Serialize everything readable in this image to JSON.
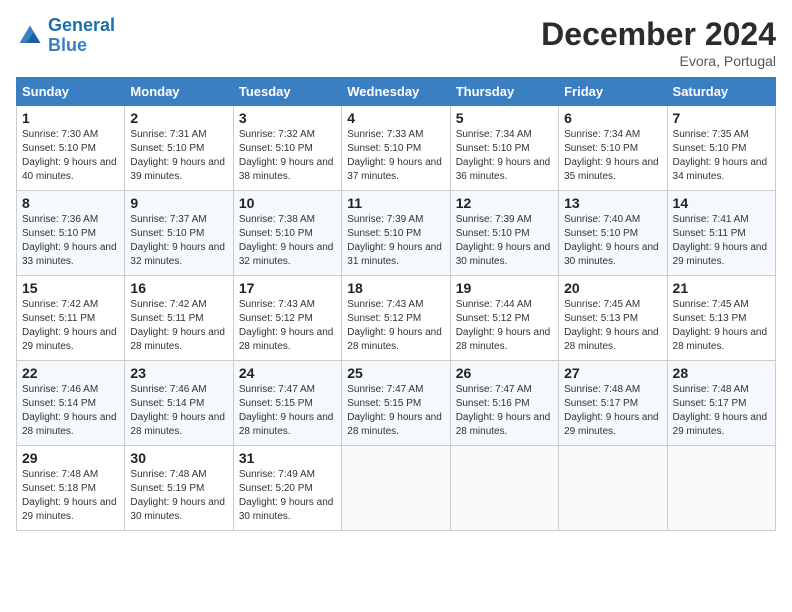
{
  "header": {
    "logo_line1": "General",
    "logo_line2": "Blue",
    "month": "December 2024",
    "location": "Evora, Portugal"
  },
  "weekdays": [
    "Sunday",
    "Monday",
    "Tuesday",
    "Wednesday",
    "Thursday",
    "Friday",
    "Saturday"
  ],
  "weeks": [
    [
      {
        "day": "1",
        "sunrise": "7:30 AM",
        "sunset": "5:10 PM",
        "daylight": "9 hours and 40 minutes."
      },
      {
        "day": "2",
        "sunrise": "7:31 AM",
        "sunset": "5:10 PM",
        "daylight": "9 hours and 39 minutes."
      },
      {
        "day": "3",
        "sunrise": "7:32 AM",
        "sunset": "5:10 PM",
        "daylight": "9 hours and 38 minutes."
      },
      {
        "day": "4",
        "sunrise": "7:33 AM",
        "sunset": "5:10 PM",
        "daylight": "9 hours and 37 minutes."
      },
      {
        "day": "5",
        "sunrise": "7:34 AM",
        "sunset": "5:10 PM",
        "daylight": "9 hours and 36 minutes."
      },
      {
        "day": "6",
        "sunrise": "7:34 AM",
        "sunset": "5:10 PM",
        "daylight": "9 hours and 35 minutes."
      },
      {
        "day": "7",
        "sunrise": "7:35 AM",
        "sunset": "5:10 PM",
        "daylight": "9 hours and 34 minutes."
      }
    ],
    [
      {
        "day": "8",
        "sunrise": "7:36 AM",
        "sunset": "5:10 PM",
        "daylight": "9 hours and 33 minutes."
      },
      {
        "day": "9",
        "sunrise": "7:37 AM",
        "sunset": "5:10 PM",
        "daylight": "9 hours and 32 minutes."
      },
      {
        "day": "10",
        "sunrise": "7:38 AM",
        "sunset": "5:10 PM",
        "daylight": "9 hours and 32 minutes."
      },
      {
        "day": "11",
        "sunrise": "7:39 AM",
        "sunset": "5:10 PM",
        "daylight": "9 hours and 31 minutes."
      },
      {
        "day": "12",
        "sunrise": "7:39 AM",
        "sunset": "5:10 PM",
        "daylight": "9 hours and 30 minutes."
      },
      {
        "day": "13",
        "sunrise": "7:40 AM",
        "sunset": "5:10 PM",
        "daylight": "9 hours and 30 minutes."
      },
      {
        "day": "14",
        "sunrise": "7:41 AM",
        "sunset": "5:11 PM",
        "daylight": "9 hours and 29 minutes."
      }
    ],
    [
      {
        "day": "15",
        "sunrise": "7:42 AM",
        "sunset": "5:11 PM",
        "daylight": "9 hours and 29 minutes."
      },
      {
        "day": "16",
        "sunrise": "7:42 AM",
        "sunset": "5:11 PM",
        "daylight": "9 hours and 28 minutes."
      },
      {
        "day": "17",
        "sunrise": "7:43 AM",
        "sunset": "5:12 PM",
        "daylight": "9 hours and 28 minutes."
      },
      {
        "day": "18",
        "sunrise": "7:43 AM",
        "sunset": "5:12 PM",
        "daylight": "9 hours and 28 minutes."
      },
      {
        "day": "19",
        "sunrise": "7:44 AM",
        "sunset": "5:12 PM",
        "daylight": "9 hours and 28 minutes."
      },
      {
        "day": "20",
        "sunrise": "7:45 AM",
        "sunset": "5:13 PM",
        "daylight": "9 hours and 28 minutes."
      },
      {
        "day": "21",
        "sunrise": "7:45 AM",
        "sunset": "5:13 PM",
        "daylight": "9 hours and 28 minutes."
      }
    ],
    [
      {
        "day": "22",
        "sunrise": "7:46 AM",
        "sunset": "5:14 PM",
        "daylight": "9 hours and 28 minutes."
      },
      {
        "day": "23",
        "sunrise": "7:46 AM",
        "sunset": "5:14 PM",
        "daylight": "9 hours and 28 minutes."
      },
      {
        "day": "24",
        "sunrise": "7:47 AM",
        "sunset": "5:15 PM",
        "daylight": "9 hours and 28 minutes."
      },
      {
        "day": "25",
        "sunrise": "7:47 AM",
        "sunset": "5:15 PM",
        "daylight": "9 hours and 28 minutes."
      },
      {
        "day": "26",
        "sunrise": "7:47 AM",
        "sunset": "5:16 PM",
        "daylight": "9 hours and 28 minutes."
      },
      {
        "day": "27",
        "sunrise": "7:48 AM",
        "sunset": "5:17 PM",
        "daylight": "9 hours and 29 minutes."
      },
      {
        "day": "28",
        "sunrise": "7:48 AM",
        "sunset": "5:17 PM",
        "daylight": "9 hours and 29 minutes."
      }
    ],
    [
      {
        "day": "29",
        "sunrise": "7:48 AM",
        "sunset": "5:18 PM",
        "daylight": "9 hours and 29 minutes."
      },
      {
        "day": "30",
        "sunrise": "7:48 AM",
        "sunset": "5:19 PM",
        "daylight": "9 hours and 30 minutes."
      },
      {
        "day": "31",
        "sunrise": "7:49 AM",
        "sunset": "5:20 PM",
        "daylight": "9 hours and 30 minutes."
      },
      null,
      null,
      null,
      null
    ]
  ]
}
